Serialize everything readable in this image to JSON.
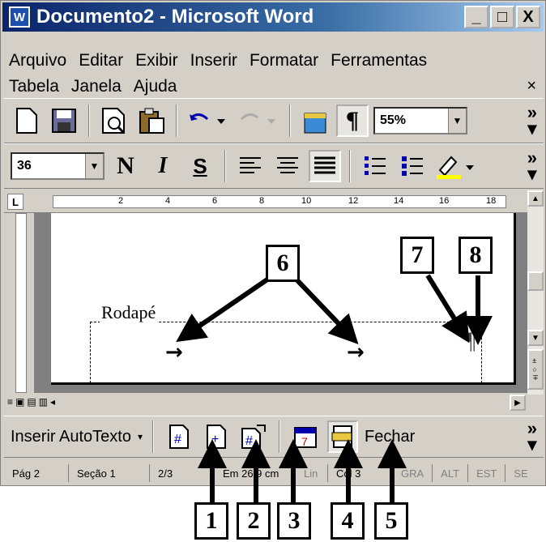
{
  "window": {
    "title": "Documento2 - Microsoft Word",
    "word_icon": "W",
    "minimize": "_",
    "maximize": "□",
    "close": "X"
  },
  "menu": {
    "row1": [
      "Arquivo",
      "Editar",
      "Exibir",
      "Inserir",
      "Formatar",
      "Ferramentas"
    ],
    "row2": [
      "Tabela",
      "Janela",
      "Ajuda"
    ],
    "close": "×"
  },
  "toolbar1": {
    "zoom": "55%",
    "more": "»"
  },
  "toolbar2": {
    "font_size": "36",
    "bold": "N",
    "italic": "I",
    "strike": "S",
    "more": "»"
  },
  "ruler": {
    "corner": "L",
    "ticks": [
      "2",
      "4",
      "6",
      "8",
      "10",
      "12",
      "14",
      "16",
      "18"
    ]
  },
  "document": {
    "footer_label": "Rodapé",
    "tab_mark": "→",
    "pilcrow": "¶"
  },
  "hf_toolbar": {
    "autotext": "Inserir AutoTexto",
    "close": "Fechar",
    "more": "»"
  },
  "statusbar": {
    "page": "Pág 2",
    "section": "Seção 1",
    "pages": "2/3",
    "position": "Em 26,9 cm",
    "line": "Lin",
    "col": "Col 3",
    "gra": "GRA",
    "alt": "ALT",
    "est": "EST",
    "se": "SE"
  },
  "callouts": [
    "1",
    "2",
    "3",
    "4",
    "5",
    "6",
    "7",
    "8"
  ],
  "colors": {
    "title_start": "#0a246a",
    "title_end": "#a6caf0",
    "chrome": "#d4d0c8"
  }
}
